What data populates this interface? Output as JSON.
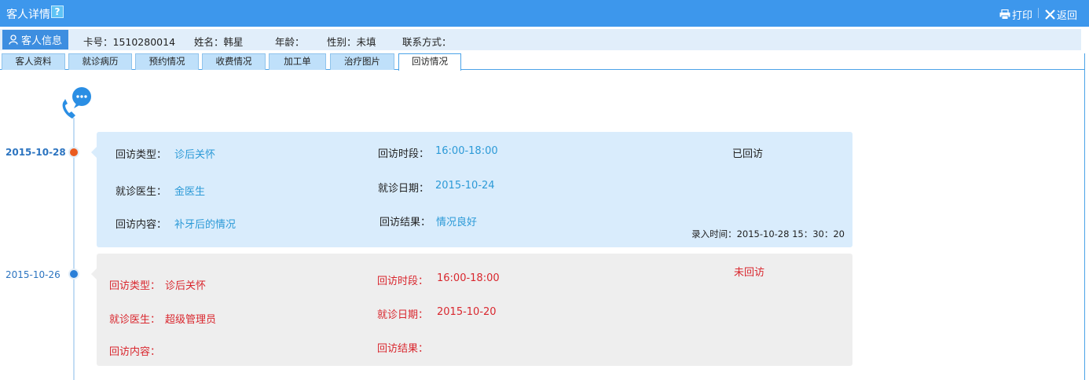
{
  "window": {
    "title": "客人详情",
    "help_label": "?",
    "print_label": "打印",
    "back_label": "返回"
  },
  "infobar": {
    "guest_info_label": "客人信息",
    "card_no": "卡号：1510280014",
    "name": "姓名：韩星",
    "age": "年龄：",
    "gender": "性别：未填",
    "contact": "联系方式："
  },
  "tabs": [
    {
      "label": "客人资料"
    },
    {
      "label": "就诊病历"
    },
    {
      "label": "预约情况"
    },
    {
      "label": "收费情况"
    },
    {
      "label": "加工单"
    },
    {
      "label": "治疗图片"
    },
    {
      "label": "回访情况",
      "active": true
    }
  ],
  "visits": [
    {
      "date": "2015-10-28",
      "dot_color": "#ea5a1e",
      "type_label": "回访类型：",
      "type_value": "诊后关怀",
      "period_label": "回访时段：",
      "period_value": "16:00-18:00",
      "status": "已回访",
      "doctor_label": "就诊医生：",
      "doctor_value": "金医生",
      "visit_date_label": "就诊日期：",
      "visit_date_value": "2015-10-24",
      "content_label": "回访内容：",
      "content_value": "补牙后的情况",
      "result_label": "回访结果：",
      "result_value": "情况良好",
      "entry_time": "录入时间：2015-10-28  15：30：20"
    },
    {
      "date": "2015-10-26",
      "dot_color": "#2a7fd8",
      "type_label": "回访类型：",
      "type_value": "诊后关怀",
      "period_label": "回访时段：",
      "period_value": "16:00-18:00",
      "status": "未回访",
      "doctor_label": "就诊医生：",
      "doctor_value": "超级管理员",
      "visit_date_label": "就诊日期：",
      "visit_date_value": "2015-10-20",
      "content_label": "回访内容：",
      "content_value": "",
      "result_label": "回访结果：",
      "result_value": ""
    }
  ],
  "colors": {
    "title_bar": "#3d97ec",
    "card_done": "#d9ecfc",
    "card_pending": "#eeeeee",
    "pending_text": "#d9272e",
    "value_text": "#2c9ad7"
  },
  "icons": {
    "help": "help-icon",
    "print": "printer-icon",
    "back": "close-icon",
    "guest": "user-icon",
    "timeline": "phone-chat-icon"
  }
}
